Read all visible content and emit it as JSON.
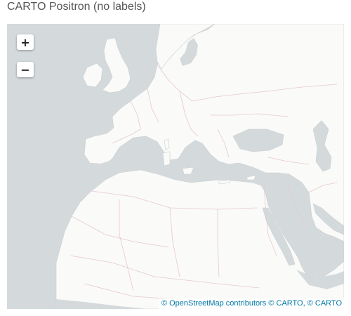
{
  "page": {
    "title": "CARTO Positron (no labels)"
  },
  "map": {
    "basemap": "CARTO Positron (no labels)",
    "region": "Europe, North Africa and Middle East",
    "colors": {
      "water": "#d4dadc",
      "land": "#fafaf8",
      "border": "#e6c9cf",
      "coast": "#c9cfd2"
    }
  },
  "controls": {
    "zoom_in_label": "+",
    "zoom_out_label": "−"
  },
  "attribution": {
    "osm_text": "© OpenStreetMap contributors",
    "carto_text": "© CARTO,",
    "carto_text_2": "© CARTO"
  }
}
